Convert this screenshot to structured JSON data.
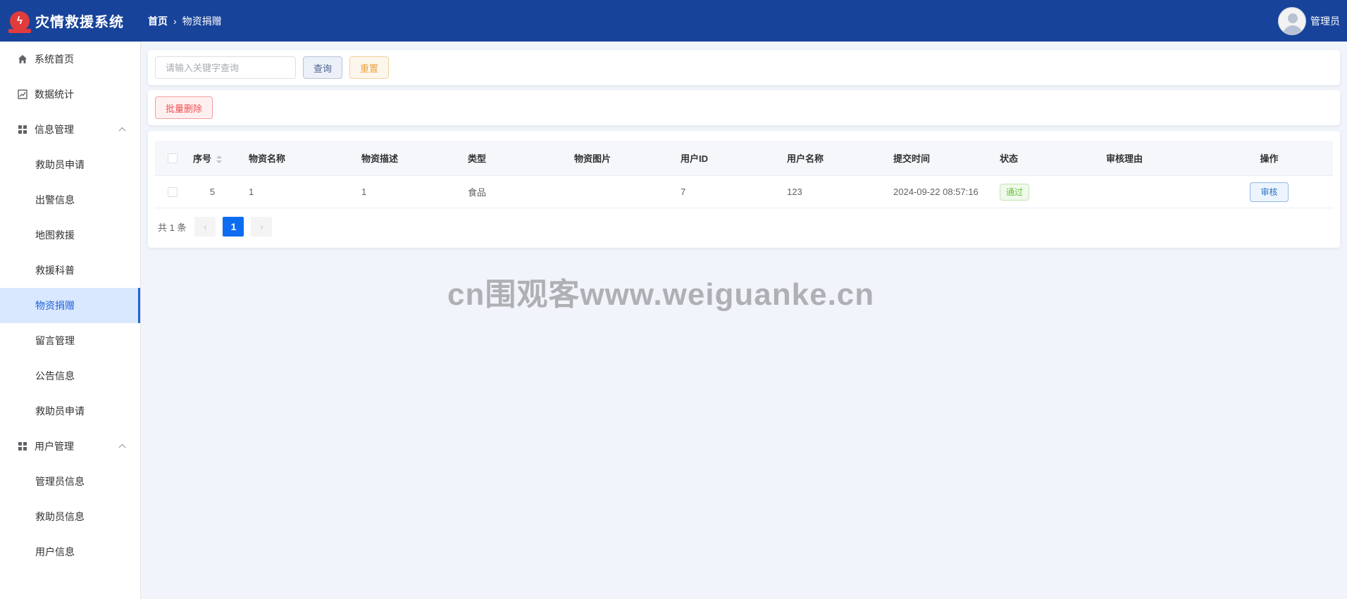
{
  "header": {
    "logo_glyph": "ϟ",
    "app_title": "灾情救援系统",
    "breadcrumb_home": "首页",
    "breadcrumb_sep": "›",
    "breadcrumb_current": "物资捐赠",
    "user_name": "管理员",
    "bg_color": "#18439a"
  },
  "sidebar": {
    "items": [
      {
        "label": "系统首页",
        "icon": "home-icon",
        "level": 0
      },
      {
        "label": "数据统计",
        "icon": "chart-icon",
        "level": 0
      },
      {
        "label": "信息管理",
        "icon": "grid-icon",
        "level": 0,
        "expanded": true
      },
      {
        "label": "救助员申请",
        "level": 1
      },
      {
        "label": "出警信息",
        "level": 1
      },
      {
        "label": "地图救援",
        "level": 1
      },
      {
        "label": "救援科普",
        "level": 1
      },
      {
        "label": "物资捐赠",
        "level": 1,
        "active": true
      },
      {
        "label": "留言管理",
        "level": 1
      },
      {
        "label": "公告信息",
        "level": 1
      },
      {
        "label": "救助员申请",
        "level": 1
      },
      {
        "label": "用户管理",
        "icon": "grid-icon",
        "level": 0,
        "expanded": true
      },
      {
        "label": "管理员信息",
        "level": 1
      },
      {
        "label": "救助员信息",
        "level": 1
      },
      {
        "label": "用户信息",
        "level": 1
      }
    ],
    "active_color": "#1f63d8"
  },
  "search": {
    "placeholder": "请输入关键字查询",
    "query_label": "查询",
    "reset_label": "重置"
  },
  "actions": {
    "batch_delete_label": "批量删除"
  },
  "table": {
    "headers": {
      "seq": "序号",
      "name": "物资名称",
      "desc": "物资描述",
      "type": "类型",
      "image": "物资图片",
      "user_id": "用户ID",
      "user_name": "用户名称",
      "submit_time": "提交时间",
      "status": "状态",
      "reason": "审核理由",
      "operation": "操作"
    },
    "rows": [
      {
        "seq": "5",
        "name": "1",
        "desc": "1",
        "type": "食品",
        "image": "",
        "user_id": "7",
        "user_name": "123",
        "submit_time": "2024-09-22 08:57:16",
        "status": "通过",
        "reason": "",
        "operation": "审核"
      }
    ]
  },
  "pagination": {
    "total_text": "共 1 条",
    "prev": "‹",
    "current": "1",
    "next": "›"
  },
  "watermark": "cn围观客www.weiguanke.cn"
}
